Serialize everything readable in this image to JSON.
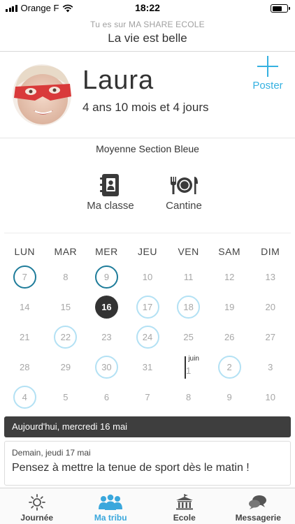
{
  "status_bar": {
    "carrier": "Orange F",
    "time": "18:22",
    "battery_level": 0.72
  },
  "header": {
    "subtitle": "Tu es sur MA SHARE ECOLE",
    "title": "La vie est belle"
  },
  "profile": {
    "name": "Laura",
    "age": "4 ans 10 mois et 4 jours",
    "poster_label": "Poster"
  },
  "classroom": {
    "name": "Moyenne Section Bleue",
    "shortcuts": [
      {
        "label": "Ma classe",
        "icon": "contacts-book-icon"
      },
      {
        "label": "Cantine",
        "icon": "plate-cutlery-icon"
      }
    ]
  },
  "calendar": {
    "days": [
      "LUN",
      "MAR",
      "MER",
      "JEU",
      "VEN",
      "SAM",
      "DIM"
    ],
    "month_label": "juin",
    "weeks": [
      [
        "7",
        "8",
        "9",
        "10",
        "11",
        "12",
        "13"
      ],
      [
        "14",
        "15",
        "16",
        "17",
        "18",
        "19",
        "20"
      ],
      [
        "21",
        "22",
        "23",
        "24",
        "25",
        "26",
        "27"
      ],
      [
        "28",
        "29",
        "30",
        "31",
        "1",
        "2",
        "3"
      ],
      [
        "4",
        "5",
        "6",
        "7",
        "8",
        "9",
        "10"
      ]
    ]
  },
  "today_bar": {
    "label": "Aujourd'hui, mercredi 16 mai"
  },
  "card": {
    "date": "Demain, jeudi 17 mai",
    "text": "Pensez à mettre la tenue de sport dès le matin !"
  },
  "tabs": [
    {
      "label": "Journée",
      "icon": "sun-icon"
    },
    {
      "label": "Ma tribu",
      "icon": "family-icon"
    },
    {
      "label": "Ecole",
      "icon": "school-icon"
    },
    {
      "label": "Messagerie",
      "icon": "chat-bubbles-icon"
    }
  ],
  "colors": {
    "accent": "#35b1e1",
    "event_ring": "#b3e1f4",
    "past_event_ring": "#1e7c9a",
    "today_fill": "#333333"
  }
}
